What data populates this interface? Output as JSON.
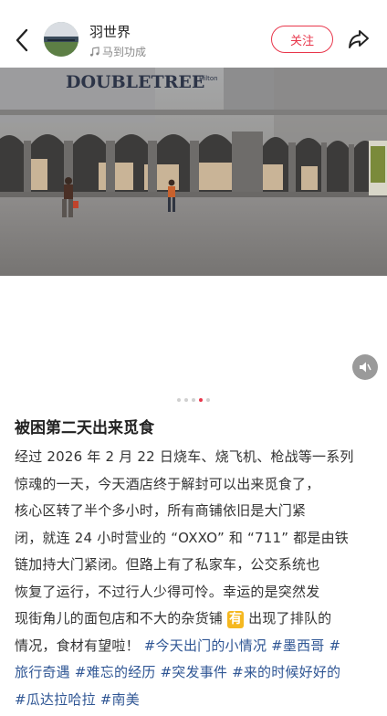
{
  "header": {
    "author_name": "羽世界",
    "music_label": "马到功成",
    "follow_label": "关注",
    "back_icon": "chevron-left-icon",
    "share_icon": "share-arrow-icon"
  },
  "media": {
    "sign_text": "DOUBLETREE",
    "sign_prefix": "D",
    "sign_suffix": "Hilton",
    "carousel_total": 5,
    "carousel_active": 3,
    "mute_icon": "speaker-icon"
  },
  "post": {
    "title": "被困第二天出来觅食",
    "lines": [
      "经过 2026 年 2 月 22 日烧车、烧飞机、枪战等一系列",
      "惊魂的一天，今天酒店终于解封可以出来觅食了，",
      "核心区转了半个多小时，所有商铺依旧是大门紧",
      "闭，就连 24 小时营业的 “OXXO” 和 “711” 都是由铁",
      "链加持大门紧闭。但路上有了私家车，公交系统也",
      "恢复了运行，不过行人少得可怜。幸运的是突然发"
    ],
    "line7_before": "现街角儿的面包店和不大的杂货铺",
    "line7_emoji": "有",
    "line7_after": "出现了排队的",
    "line8_text": "情况，食材有望啦！",
    "line8_tag1": "#今天出门的小情况",
    "line8_tag2": "#墨西哥",
    "line8_tag3": "#",
    "line9_tag1": "旅行奇遇",
    "line9_tag2": "#难忘的经历",
    "line9_tag3": "#突发事件",
    "line9_tag4": "#来的时候好好的",
    "line10_tag1": "#瓜达拉哈拉",
    "line10_tag2": "#南美"
  },
  "colors": {
    "accent": "#e8364b",
    "hashtag": "#2f5694",
    "emoji_badge": "#f5b820"
  }
}
